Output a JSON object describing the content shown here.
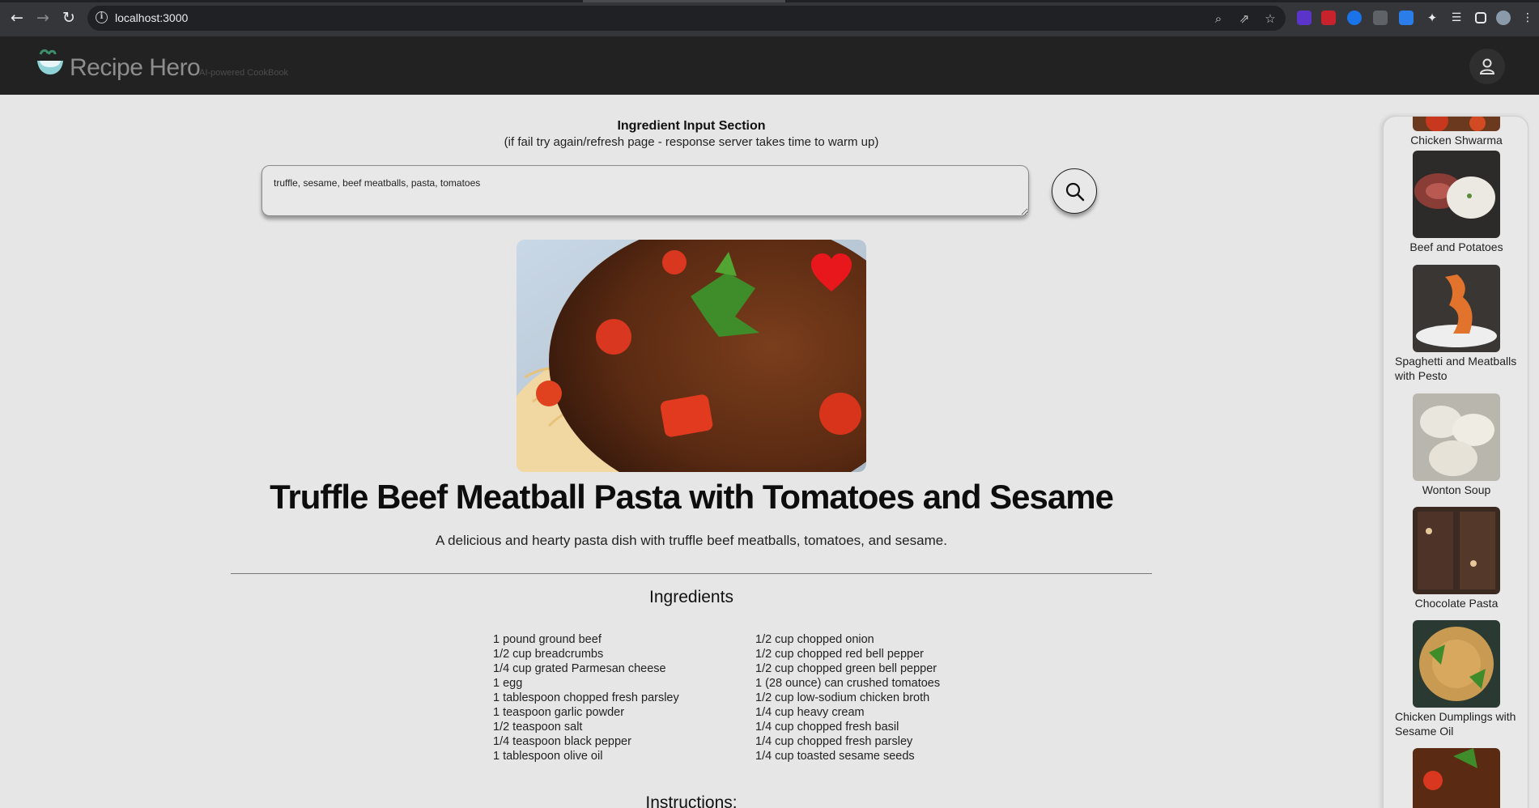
{
  "browser": {
    "url": "localhost:3000"
  },
  "header": {
    "title": "Recipe Hero",
    "tagline": "AI-powered CookBook"
  },
  "input_section": {
    "title": "Ingredient Input Section",
    "subtitle": "(if fail try again/refresh page - response server takes time to warm up)",
    "input_value": "truffle, sesame, beef meatballs, pasta, tomatoes"
  },
  "recipe": {
    "title": "Truffle Beef Meatball Pasta with Tomatoes and Sesame",
    "description": "A delicious and hearty pasta dish with truffle beef meatballs, tomatoes, and sesame.",
    "ingredients_heading": "Ingredients",
    "ingredients_left": [
      "1 pound ground beef",
      "1/2 cup breadcrumbs",
      "1/4 cup grated Parmesan cheese",
      "1 egg",
      "1 tablespoon chopped fresh parsley",
      "1 teaspoon garlic powder",
      "1/2 teaspoon salt",
      "1/4 teaspoon black pepper",
      "1 tablespoon olive oil"
    ],
    "ingredients_right": [
      "1/2 cup chopped onion",
      "1/2 cup chopped red bell pepper",
      "1/2 cup chopped green bell pepper",
      "1 (28 ounce) can crushed tomatoes",
      "1/2 cup low-sodium chicken broth",
      "1/4 cup heavy cream",
      "1/4 cup chopped fresh basil",
      "1/4 cup chopped fresh parsley",
      "1/4 cup toasted sesame seeds"
    ],
    "instructions_heading": "Instructions:"
  },
  "sidebar": {
    "items": [
      {
        "label": "Chicken Shwarma"
      },
      {
        "label": "Beef and Potatoes"
      },
      {
        "label": "Spaghetti and Meatballs with Pesto"
      },
      {
        "label": "Wonton Soup"
      },
      {
        "label": "Chocolate Pasta"
      },
      {
        "label": "Chicken Dumplings with Sesame Oil"
      }
    ]
  },
  "colors": {
    "page_bg": "#e6e6e6",
    "header_bg": "#222222",
    "heart": "#e8171c"
  },
  "icons": [
    "back-icon",
    "forward-icon",
    "reload-icon",
    "info-icon",
    "zoom-icon",
    "share-icon",
    "star-icon",
    "puzzle-icon",
    "user-icon",
    "search-icon",
    "heart-icon"
  ]
}
